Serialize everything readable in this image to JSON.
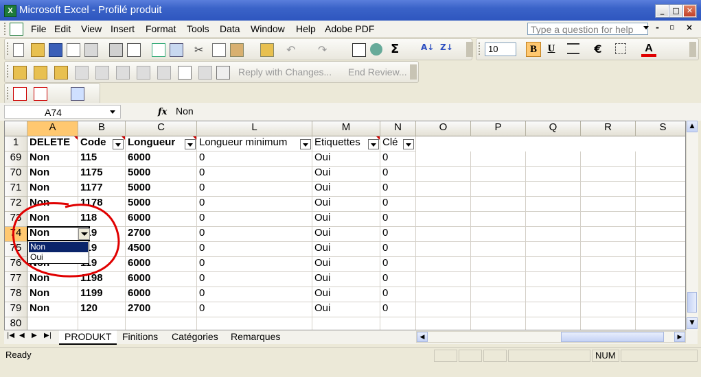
{
  "window": {
    "title": "Microsoft Excel - Profilé produit",
    "app_icon": "excel-icon"
  },
  "menu": [
    "File",
    "Edit",
    "View",
    "Insert",
    "Format",
    "Tools",
    "Data",
    "Window",
    "Help",
    "Adobe PDF"
  ],
  "ask_placeholder": "Type a question for help",
  "toolbar": {
    "font_size": "10",
    "bold": "B",
    "underline": "U",
    "euro": "€",
    "font_color": "A",
    "reply_label": "Reply with Changes...",
    "end_review_label": "End Review..."
  },
  "formula_bar": {
    "name_box": "A74",
    "fx": "fx",
    "value": "Non"
  },
  "columns": [
    "A",
    "B",
    "C",
    "L",
    "M",
    "N",
    "O",
    "P",
    "Q",
    "R",
    "S"
  ],
  "headers": [
    "DELETE",
    "Code",
    "Longueur",
    "Longueur minimum",
    "Etiquettes",
    "Clé"
  ],
  "rows": [
    {
      "n": "69",
      "a": "Non",
      "b": "115",
      "c": "6000",
      "l": "0",
      "m": "Oui",
      "nn": "0"
    },
    {
      "n": "70",
      "a": "Non",
      "b": "1175",
      "c": "5000",
      "l": "0",
      "m": "Oui",
      "nn": "0"
    },
    {
      "n": "71",
      "a": "Non",
      "b": "1177",
      "c": "5000",
      "l": "0",
      "m": "Oui",
      "nn": "0"
    },
    {
      "n": "72",
      "a": "Non",
      "b": "1178",
      "c": "5000",
      "l": "0",
      "m": "Oui",
      "nn": "0"
    },
    {
      "n": "73",
      "a": "Non",
      "b": "118",
      "c": "6000",
      "l": "0",
      "m": "Oui",
      "nn": "0"
    },
    {
      "n": "74",
      "a": "Non",
      "b": "119",
      "c": "2700",
      "l": "0",
      "m": "Oui",
      "nn": "0"
    },
    {
      "n": "75",
      "a": "",
      "b": "119",
      "c": "4500",
      "l": "0",
      "m": "Oui",
      "nn": "0"
    },
    {
      "n": "76",
      "a": "Non",
      "b": "119",
      "c": "6000",
      "l": "0",
      "m": "Oui",
      "nn": "0"
    },
    {
      "n": "77",
      "a": "Non",
      "b": "1198",
      "c": "6000",
      "l": "0",
      "m": "Oui",
      "nn": "0"
    },
    {
      "n": "78",
      "a": "Non",
      "b": "1199",
      "c": "6000",
      "l": "0",
      "m": "Oui",
      "nn": "0"
    },
    {
      "n": "79",
      "a": "Non",
      "b": "120",
      "c": "2700",
      "l": "0",
      "m": "Oui",
      "nn": "0"
    },
    {
      "n": "80",
      "a": "",
      "b": "",
      "c": "",
      "l": "",
      "m": "",
      "nn": ""
    }
  ],
  "header_row_number": "1",
  "dropdown_options": [
    "Non",
    "Oui"
  ],
  "sheet_tabs": [
    "PRODUKT",
    "Finitions",
    "Catégories",
    "Remarques"
  ],
  "status": {
    "ready": "Ready",
    "num": "NUM"
  },
  "colors": {
    "annotation": "#e00000",
    "selection": "#0a246a",
    "header_highlight": "#ffc870"
  }
}
